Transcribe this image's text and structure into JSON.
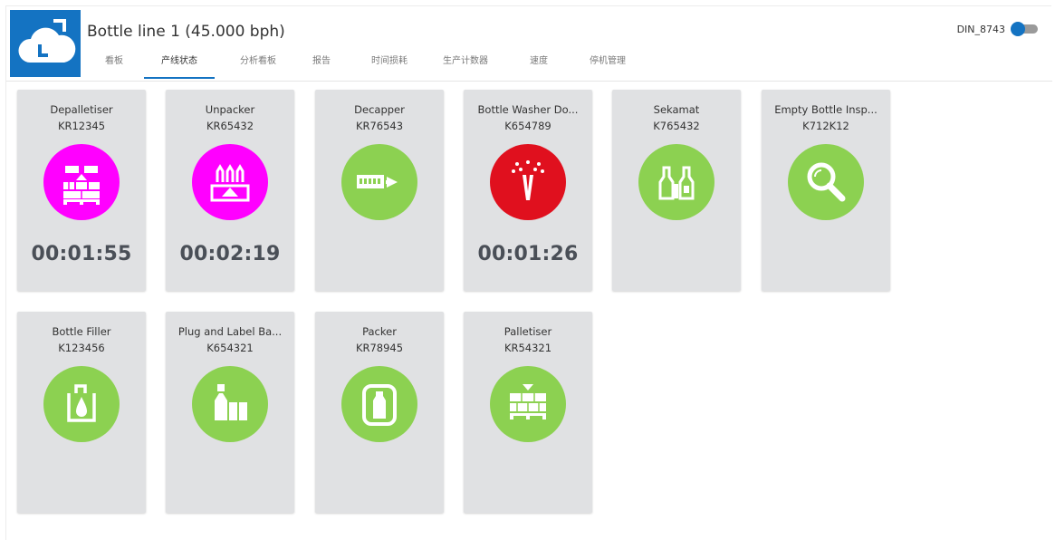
{
  "header": {
    "title": "Bottle line 1 (45.000 bph)",
    "logo_icon": "cloud-logo-icon",
    "device_label": "DIN_8743"
  },
  "tabs": [
    {
      "label": "看板",
      "active": false
    },
    {
      "label": "产线状态",
      "active": true
    },
    {
      "label": "分析看板",
      "active": false
    },
    {
      "label": "报告",
      "active": false
    },
    {
      "label": "时间损耗",
      "active": false
    },
    {
      "label": "生产计数器",
      "active": false
    },
    {
      "label": "速度",
      "active": false
    },
    {
      "label": "停机管理",
      "active": false
    }
  ],
  "colors": {
    "accent": "#1473c2",
    "tile_bg": "#e0e1e3",
    "status_running": "#8cd151",
    "status_stopped_magenta": "#ff00ff",
    "status_fault_red": "#e0101e",
    "timer_text": "#4a4f57"
  },
  "machines": [
    {
      "name": "Depalletiser",
      "id": "KR12345",
      "status_color": "#ff00ff",
      "icon": "depalletiser-icon",
      "timer": "00:01:55"
    },
    {
      "name": "Unpacker",
      "id": "KR65432",
      "status_color": "#ff00ff",
      "icon": "unpacker-icon",
      "timer": "00:02:19"
    },
    {
      "name": "Decapper",
      "id": "KR76543",
      "status_color": "#8cd151",
      "icon": "decapper-icon",
      "timer": ""
    },
    {
      "name": "Bottle Washer Do...",
      "id": "K654789",
      "status_color": "#e0101e",
      "icon": "bottle-washer-icon",
      "timer": "00:01:26"
    },
    {
      "name": "Sekamat",
      "id": "K765432",
      "status_color": "#8cd151",
      "icon": "sekamat-icon",
      "timer": ""
    },
    {
      "name": "Empty Bottle Insp...",
      "id": "K712K12",
      "status_color": "#8cd151",
      "icon": "inspector-magnifier-icon",
      "timer": ""
    },
    {
      "name": "Bottle Filler",
      "id": "K123456",
      "status_color": "#8cd151",
      "icon": "filler-icon",
      "timer": ""
    },
    {
      "name": "Plug and Label Ba...",
      "id": "K654321",
      "status_color": "#8cd151",
      "icon": "labeller-icon",
      "timer": ""
    },
    {
      "name": "Packer",
      "id": "KR78945",
      "status_color": "#8cd151",
      "icon": "packer-icon",
      "timer": ""
    },
    {
      "name": "Palletiser",
      "id": "KR54321",
      "status_color": "#8cd151",
      "icon": "palletiser-icon",
      "timer": ""
    }
  ]
}
